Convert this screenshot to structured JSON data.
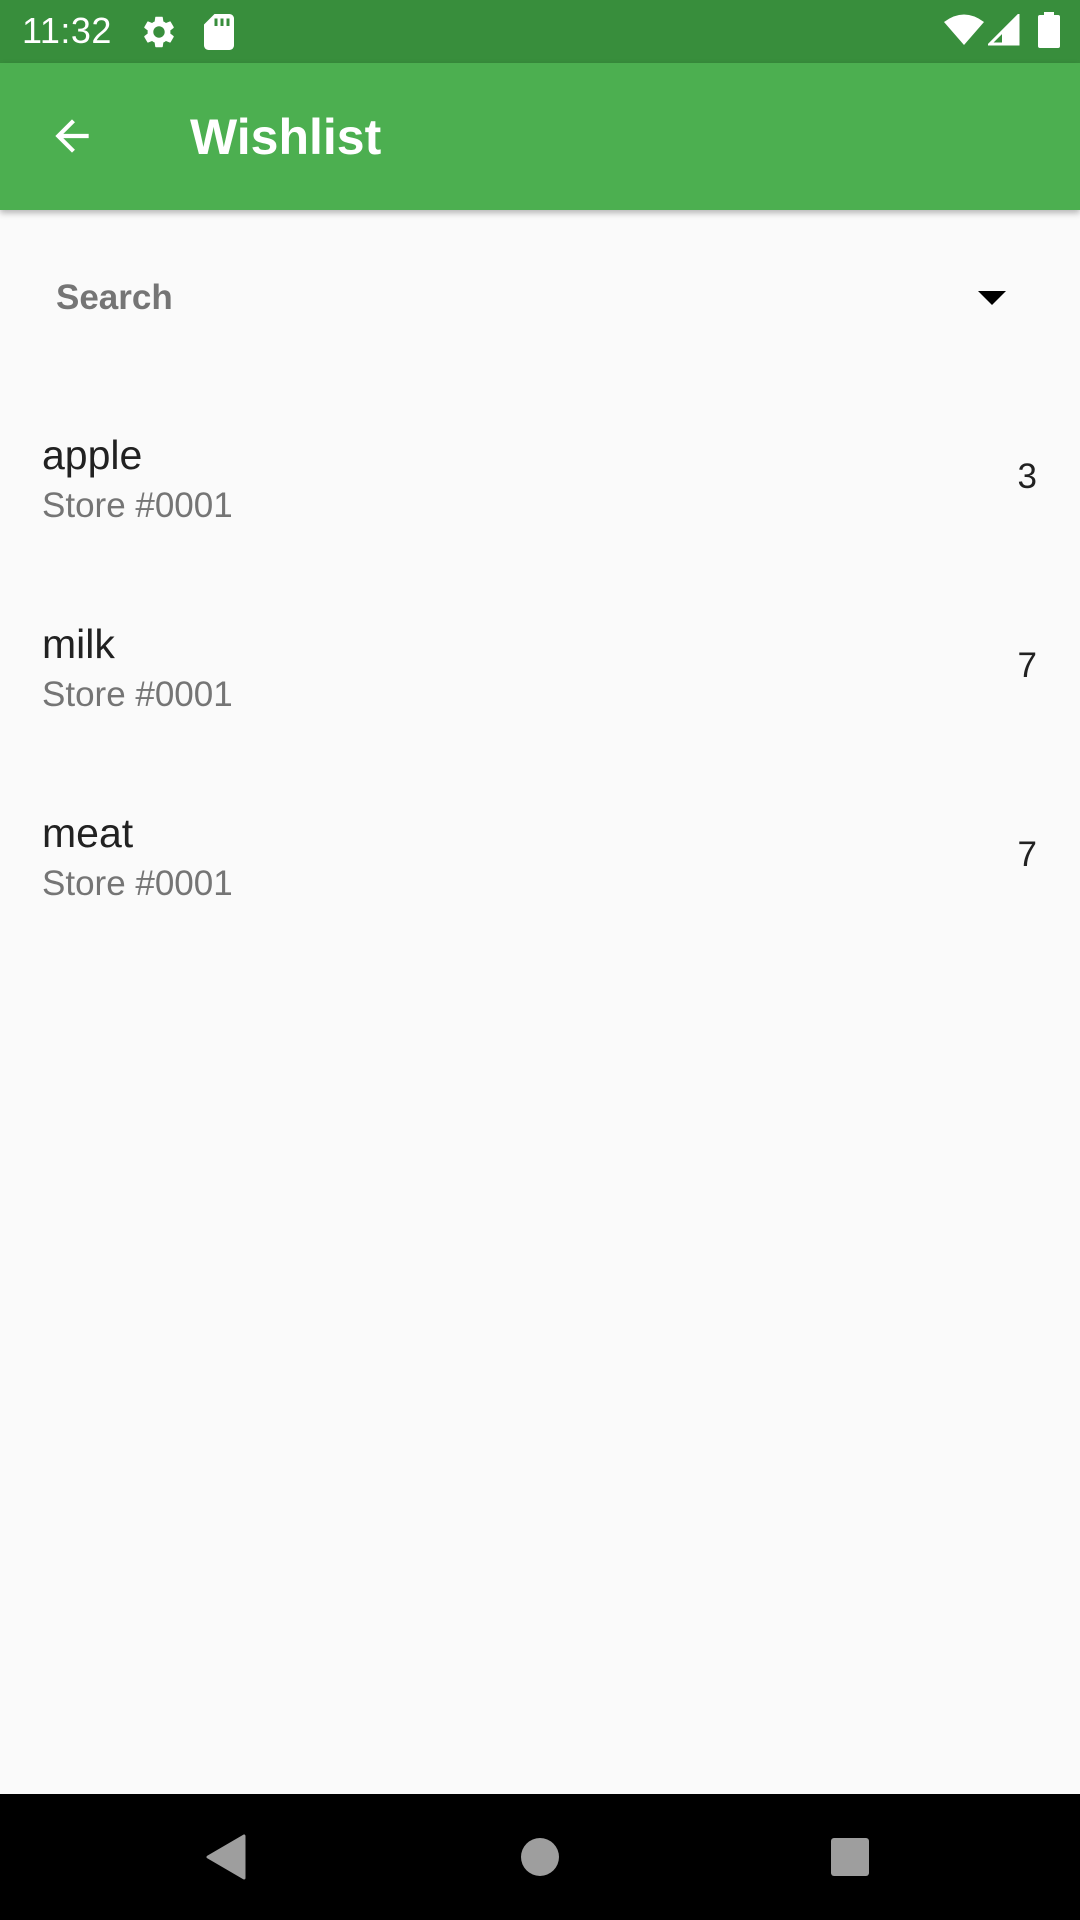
{
  "status_bar": {
    "time": "11:32",
    "icons": [
      "settings-gear-icon",
      "sd-card-icon",
      "wifi-icon",
      "cellular-signal-icon",
      "battery-icon"
    ]
  },
  "app_bar": {
    "title": "Wishlist",
    "back_icon": "arrow-back-icon",
    "background_color": "#4caf50",
    "status_bar_color": "#388e3c"
  },
  "search": {
    "label": "Search",
    "dropdown_icon": "arrow-drop-down-icon"
  },
  "items": [
    {
      "name": "apple",
      "store": "Store #0001",
      "count": "3"
    },
    {
      "name": "milk",
      "store": "Store #0001",
      "count": "7"
    },
    {
      "name": "meat",
      "store": "Store #0001",
      "count": "7"
    }
  ],
  "nav_bar": {
    "buttons": [
      "back-triangle-icon",
      "home-circle-icon",
      "recents-square-icon"
    ]
  }
}
